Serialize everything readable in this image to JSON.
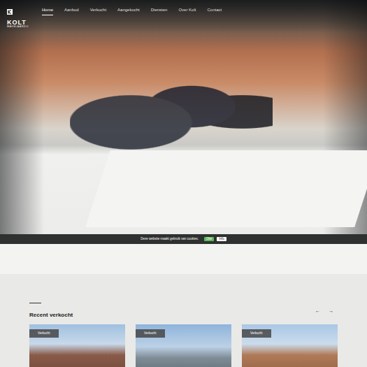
{
  "logo": {
    "title": "KOLT",
    "subtitle": "MAKELAARDIJ"
  },
  "nav": [
    {
      "label": "Home",
      "selected": true
    },
    {
      "label": "Aanbod",
      "selected": false
    },
    {
      "label": "Verkocht",
      "selected": false
    },
    {
      "label": "Aangekocht",
      "selected": false
    },
    {
      "label": "Diensten",
      "selected": false
    },
    {
      "label": "Over Kolt",
      "selected": false
    },
    {
      "label": "Contact",
      "selected": false
    }
  ],
  "cookie": {
    "text": "Deze website maakt gebruik van cookies.",
    "accept": "Oké",
    "info": "Info"
  },
  "recent": {
    "title": "Recent verkocht",
    "prev": "←",
    "next": "→",
    "cards": [
      {
        "badge": "Verkocht"
      },
      {
        "badge": "Verkocht"
      },
      {
        "badge": "Verkocht"
      }
    ]
  }
}
